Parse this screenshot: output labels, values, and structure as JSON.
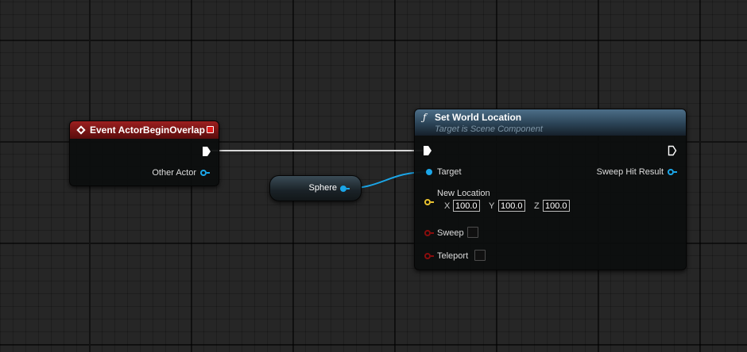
{
  "graph": {
    "event_node": {
      "title": "Event ActorBeginOverlap",
      "other_actor_label": "Other Actor"
    },
    "sphere_node": {
      "label": "Sphere"
    },
    "set_world_location": {
      "title": "Set World Location",
      "subtitle": "Target is Scene Component",
      "target_label": "Target",
      "sweep_hit_result_label": "Sweep Hit Result",
      "new_location_label": "New Location",
      "x_label": "X",
      "y_label": "Y",
      "z_label": "Z",
      "x_value": "100.0",
      "y_value": "100.0",
      "z_value": "100.0",
      "sweep_label": "Sweep",
      "teleport_label": "Teleport"
    }
  },
  "colors": {
    "event_header": "#8b1a1a",
    "function_header": "#3c5a72",
    "object_pin": "#1ba6e8",
    "vector_pin": "#e9c22f",
    "bool_pin": "#8a0d0d",
    "exec_wire": "#ffffff",
    "grid_background": "#262626"
  }
}
